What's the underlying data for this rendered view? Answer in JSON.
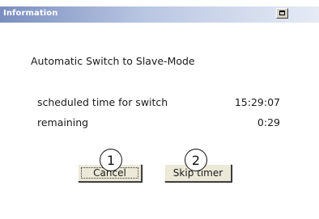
{
  "window": {
    "title": "Information",
    "title_button_icon": "restore-icon"
  },
  "dialog": {
    "heading": "Automatic Switch to Slave-Mode",
    "rows": [
      {
        "label": "scheduled time for switch",
        "value": "15:29:07"
      },
      {
        "label": "remaining",
        "value": "0:29"
      }
    ]
  },
  "buttons": {
    "cancel_label": "Cancel",
    "skip_timer_label": "Skip timer"
  },
  "callouts": [
    "1",
    "2"
  ]
}
